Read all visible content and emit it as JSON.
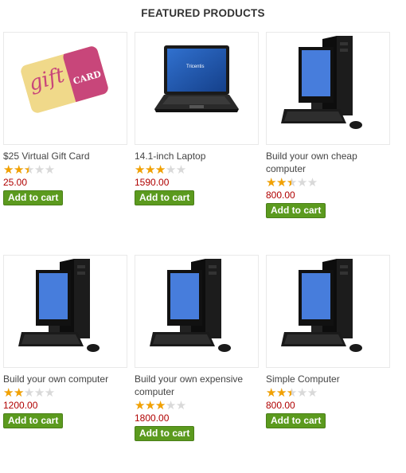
{
  "section_title": "FEATURED PRODUCTS",
  "colors": {
    "price": "#b00000",
    "button": "#5b9a1e",
    "star": "#f2a100"
  },
  "products": [
    {
      "name": "$25 Virtual Gift Card",
      "price": "25.00",
      "rating": 0.5,
      "button": "Add to cart",
      "image": "gift-card-image",
      "logo_text": [
        "gift",
        "CARD"
      ]
    },
    {
      "name": "14.1-inch Laptop",
      "price": "1590.00",
      "rating": 0.6,
      "button": "Add to cart",
      "image": "laptop-image",
      "logo_text": [
        "Tricentis"
      ]
    },
    {
      "name": "Build your own cheap computer",
      "price": "800.00",
      "rating": 0.5,
      "button": "Add to cart",
      "image": "desktop-computer-image"
    },
    {
      "name": "Build your own computer",
      "price": "1200.00",
      "rating": 0.4,
      "button": "Add to cart",
      "image": "desktop-computer-image"
    },
    {
      "name": "Build your own expensive computer",
      "price": "1800.00",
      "rating": 0.6,
      "button": "Add to cart",
      "image": "desktop-computer-image"
    },
    {
      "name": "Simple Computer",
      "price": "800.00",
      "rating": 0.5,
      "button": "Add to cart",
      "image": "desktop-computer-image"
    }
  ]
}
